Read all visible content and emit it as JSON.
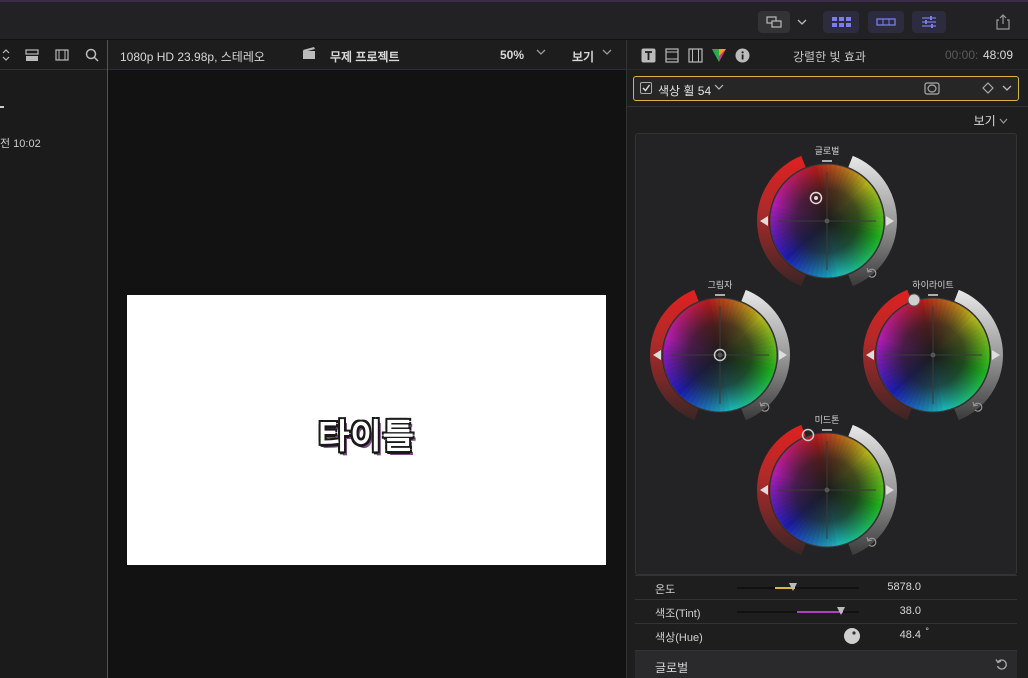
{
  "viewer": {
    "format": "1080p HD 23.98p, 스테레오",
    "project": "무제 프로젝트",
    "zoom": "50%",
    "view_label": "보기",
    "title_text": "타이틀"
  },
  "browser": {
    "date_text": "전 10:02"
  },
  "inspector": {
    "effect_name": "강렬한 빛 효과",
    "timecode_dim": "00:00:",
    "timecode": "48:09",
    "color_wheel_label": "색상 휠 54",
    "view_label": "보기",
    "wheels": {
      "master": "글로벌",
      "shadows": "그림자",
      "highlights": "하이라이트",
      "midtones": "미드톤"
    },
    "params": [
      {
        "label": "온도",
        "value": "5878.0"
      },
      {
        "label": "색조(Tint)",
        "value": "38.0"
      },
      {
        "label": "색상(Hue)",
        "value": "48.4"
      }
    ],
    "params_hue_unit": "°",
    "global_label": "글로벌"
  },
  "colors": {
    "accent": "#d7b53c",
    "selected_blue": "#7c7cf0",
    "panel": "#1e1e1f"
  }
}
